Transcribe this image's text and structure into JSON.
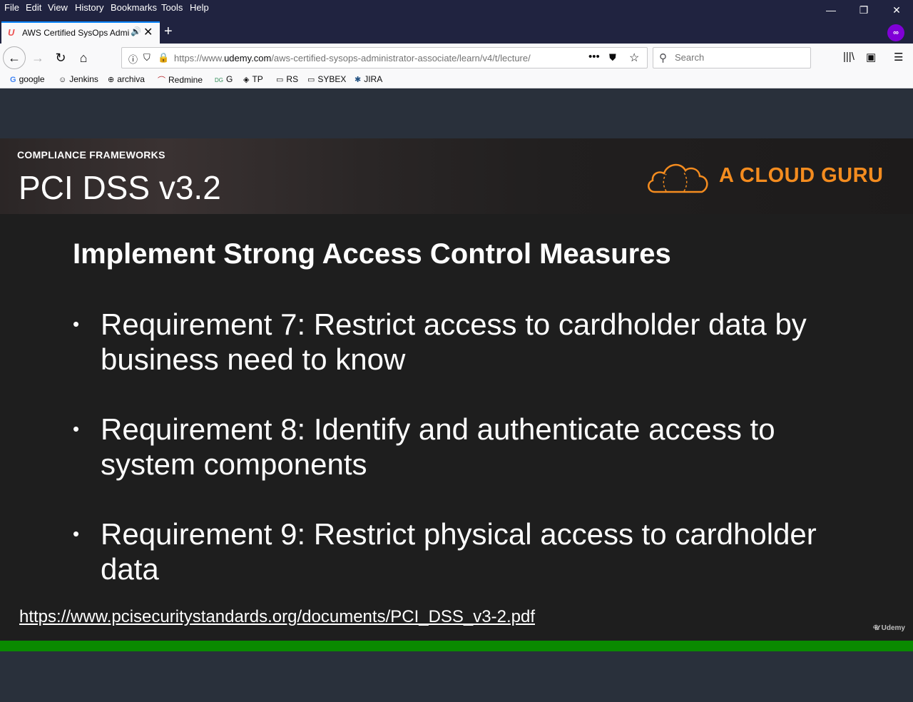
{
  "menu": [
    "File",
    "Edit",
    "View",
    "History",
    "Bookmarks",
    "Tools",
    "Help"
  ],
  "tab": {
    "title": "AWS Certified SysOps Administrator",
    "close": "✕"
  },
  "navbar": {
    "url_prefix": "https://www.",
    "url_domain": "udemy.com",
    "url_path": "/aws-certified-sysops-administrator-associate/learn/v4/t/lecture/",
    "search_placeholder": "Search"
  },
  "bookmarks": [
    {
      "label": "google",
      "icon": "google-icon"
    },
    {
      "label": "Jenkins",
      "icon": "jenkins-icon"
    },
    {
      "label": "archiva",
      "icon": "globe-icon"
    },
    {
      "label": "Redmine",
      "icon": "redmine-icon"
    },
    {
      "label": "G",
      "icon": "g-site-icon"
    },
    {
      "label": "TP",
      "icon": "tp-icon"
    },
    {
      "label": "RS",
      "icon": "folder-icon"
    },
    {
      "label": "SYBEX",
      "icon": "folder-icon"
    },
    {
      "label": "JIRA",
      "icon": "jira-icon"
    }
  ],
  "slide": {
    "kicker": "COMPLIANCE FRAMEWORKS",
    "title": "PCI DSS v3.2",
    "brand": "A CLOUD GURU",
    "heading": "Implement Strong Access Control Measures",
    "bullets": [
      "Requirement 7: Restrict access to cardholder data by business need to know",
      "Requirement 8: Identify and authenticate access to system components",
      "Requirement 9: Restrict physical access to cardholder data"
    ],
    "link": "https://www.pcisecuritystandards.org/documents/PCI_DSS_v3-2.pdf",
    "watermark": "Udemy"
  },
  "player": {
    "progress_percent": 100
  },
  "colors": {
    "brand_orange": "#f48c1f",
    "progress_green": "#0a8a00",
    "chrome_dark": "#202340"
  }
}
